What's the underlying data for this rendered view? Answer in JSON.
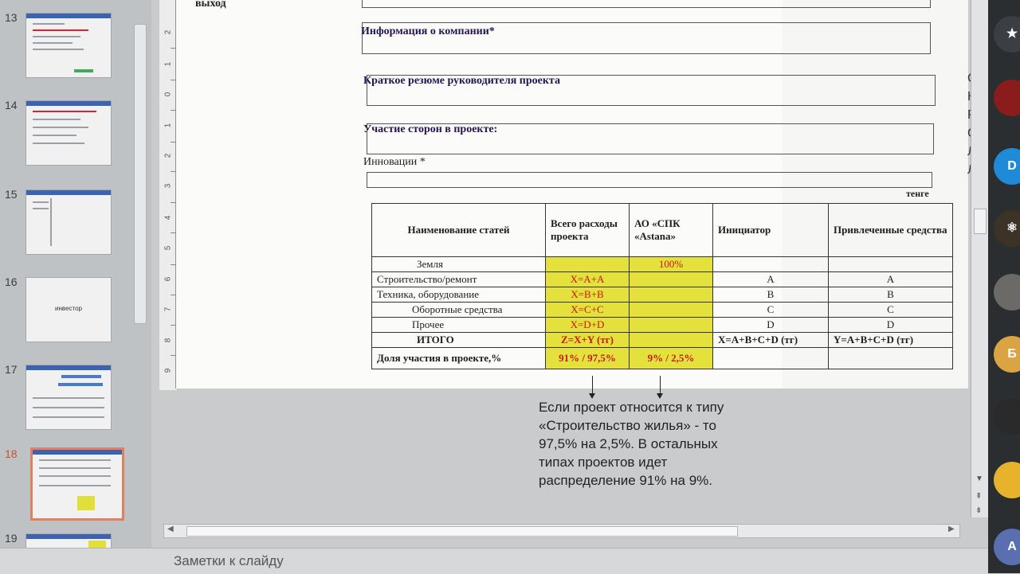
{
  "thumbnails": [
    {
      "number": "13",
      "active": false
    },
    {
      "number": "14",
      "active": false
    },
    {
      "number": "15",
      "active": false
    },
    {
      "number": "16",
      "active": false,
      "caption": "инвестор"
    },
    {
      "number": "17",
      "active": false
    },
    {
      "number": "18",
      "active": true
    },
    {
      "number": "19",
      "active": false
    }
  ],
  "slide": {
    "exit_label": "выход",
    "fields": {
      "company_info": "Информация о компании*",
      "manager_resume": "Краткое резюме руководителя проекта",
      "participation": "Участие сторон в проекте:",
      "innovations": "Инновации *"
    },
    "currency": "тенге",
    "right_cut_letters": [
      "С",
      "К",
      "Р",
      "С",
      "Л",
      "Л"
    ],
    "table": {
      "headers": [
        "Наименование статей",
        "Всего расходы проекта",
        "АО «СПК «Astana»",
        "Инициатор",
        "Привлеченные средства"
      ],
      "rows": [
        {
          "name": "Земля",
          "total": "",
          "spk": "100%",
          "initiator": "",
          "attracted": ""
        },
        {
          "name": "Строительство/ремонт",
          "total": "X=A+A",
          "spk": "",
          "initiator": "A",
          "attracted": "A"
        },
        {
          "name": "Техника, оборудование",
          "total": "X=B+B",
          "spk": "",
          "initiator": "B",
          "attracted": "B"
        },
        {
          "name": "Оборотные средства",
          "total": "X=C+C",
          "spk": "",
          "initiator": "C",
          "attracted": "C"
        },
        {
          "name": "Прочее",
          "total": "X=D+D",
          "spk": "",
          "initiator": "D",
          "attracted": "D"
        },
        {
          "name": "ИТОГО",
          "total": "Z=X+Y (тг)",
          "spk": "",
          "initiator": "X=A+B+C+D (тг)",
          "attracted": "Y=A+B+C+D (тг)"
        },
        {
          "name": "Доля участия в проекте,%",
          "total": "91% / 97,5%",
          "spk": "9% / 2,5%",
          "initiator": "",
          "attracted": ""
        }
      ]
    },
    "note": "Если проект относится к типу «Строительство жилья» - то 97,5% на 2,5%. В остальных типах проектов идет распределение 91% на 9%."
  },
  "notes_placeholder": "Заметки к слайду",
  "colors": {
    "highlight": "#e4e13c",
    "accent_red": "#c41818",
    "active_thumb": "#e0805e"
  }
}
